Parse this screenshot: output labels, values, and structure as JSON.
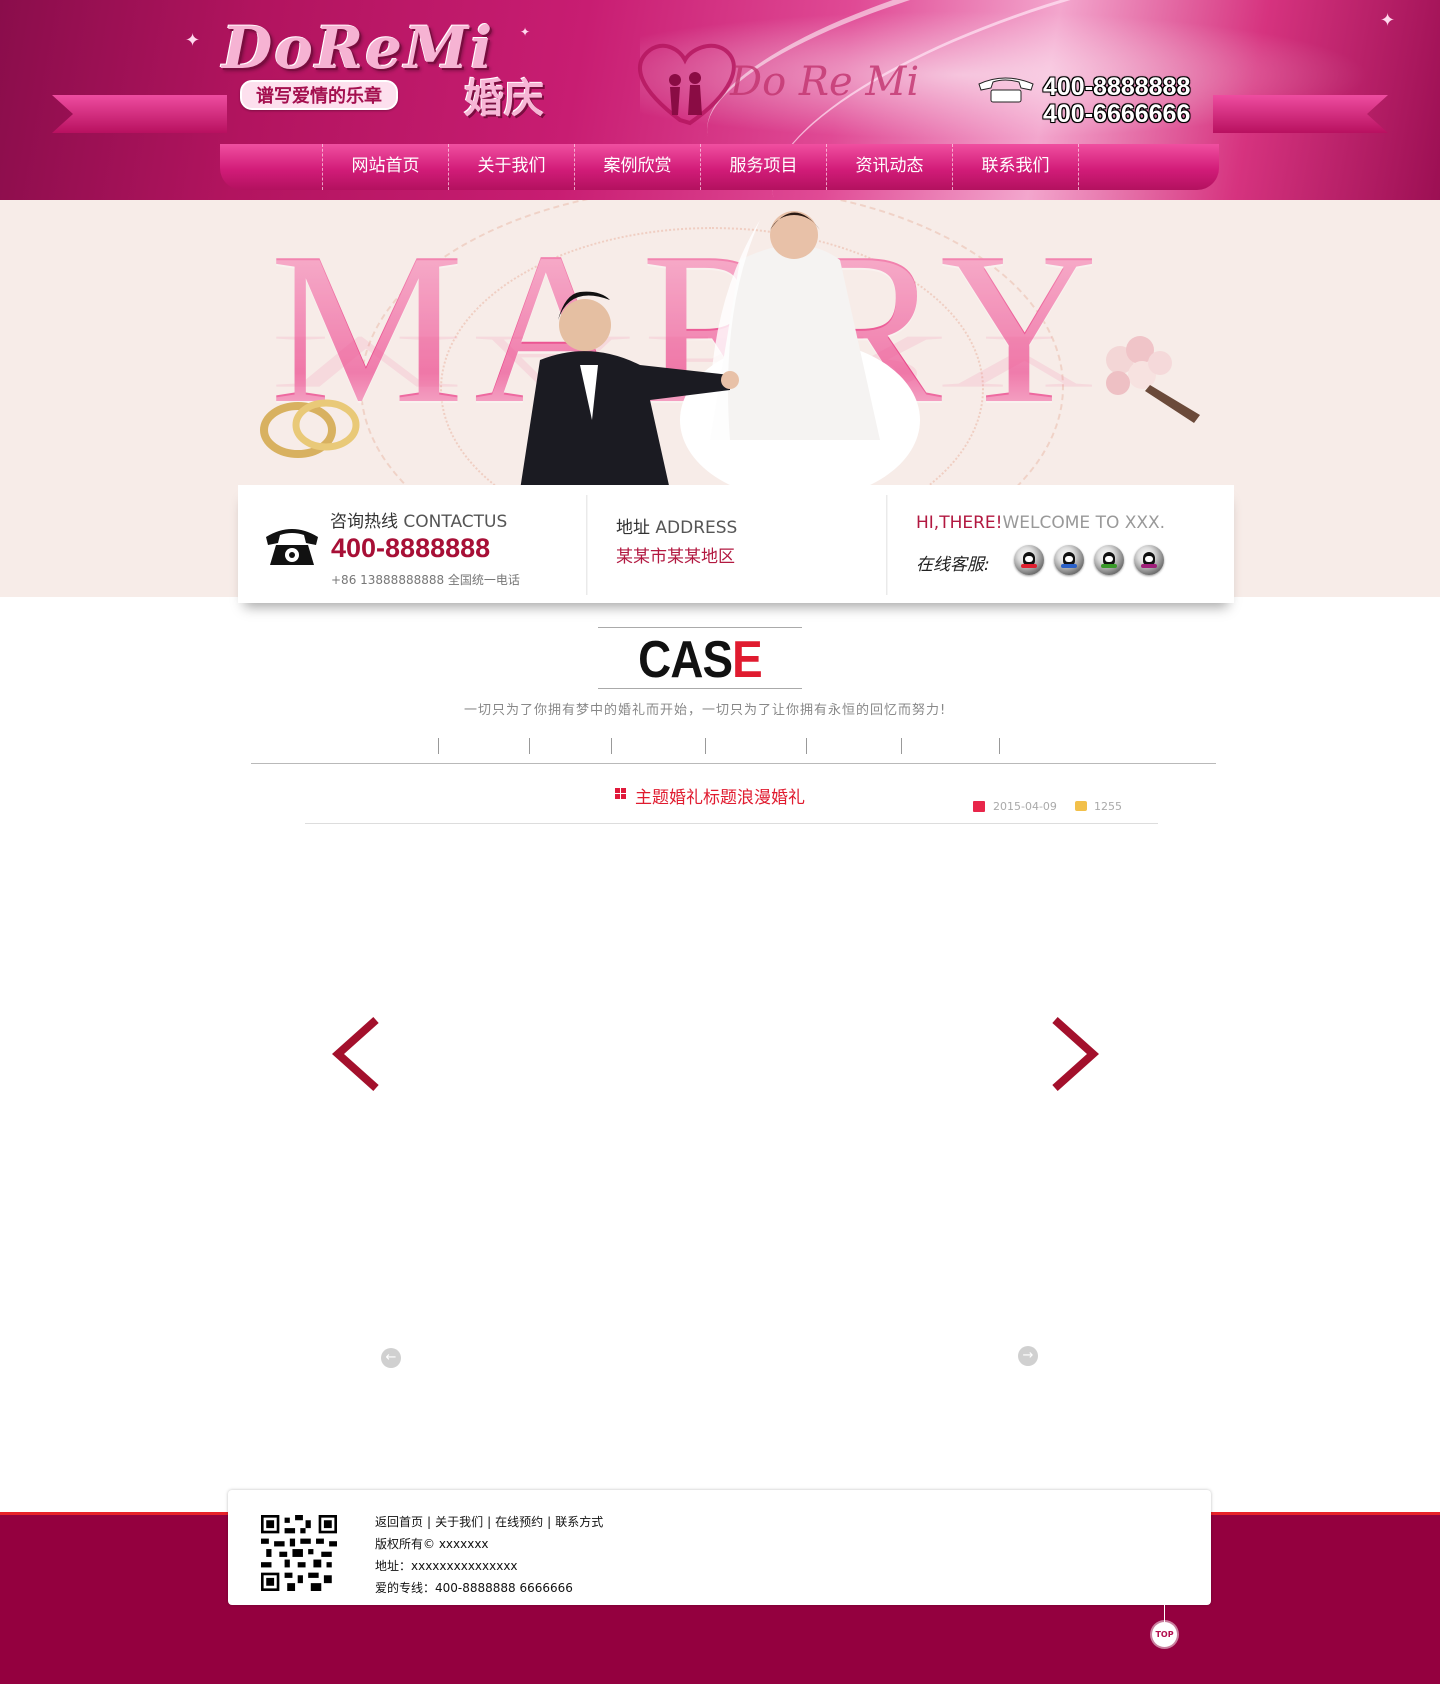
{
  "header": {
    "logo_word": "DoReMi",
    "logo_word_small": "婚庆",
    "slogan": "谱写爱情的乐章",
    "phones": [
      "400-8888888",
      "400-6666666"
    ]
  },
  "nav": {
    "items": [
      {
        "label": "网站首页"
      },
      {
        "label": "关于我们"
      },
      {
        "label": "案例欣赏"
      },
      {
        "label": "服务项目"
      },
      {
        "label": "资讯动态"
      },
      {
        "label": "联系我们"
      }
    ]
  },
  "banner": {
    "headline": "MARRY"
  },
  "contact": {
    "consult_label": "咨询热线",
    "consult_label_en": "CONTACTUS",
    "consult_number": "400-8888888",
    "consult_sub": "+86 13888888888 全国统一电话",
    "address_label": "地址",
    "address_label_en": "ADDRESS",
    "address_value": "某某市某某地区",
    "greeting_red": "HI,THERE!",
    "greeting_grey": "WELCOME TO XXX.",
    "service_label": "在线客服:",
    "qq_colors": [
      "#e02030",
      "#2b61c9",
      "#3a9a2a",
      "#a0207a"
    ]
  },
  "case": {
    "title_main": "CAS",
    "title_accent": "E",
    "tagline": "一切只为了你拥有梦中的婚礼而开始，一切只为了让你拥有永恒的回忆而努力!",
    "item": {
      "title": "主题婚礼标题浪漫婚礼",
      "date": "2015-04-09",
      "views": "1255"
    },
    "prev_small_icon": "←",
    "next_small_icon": "→"
  },
  "footer": {
    "links": [
      "返回首页",
      "关于我们",
      "在线预约",
      "联系方式"
    ],
    "copyright": "版权所有©   xxxxxxx",
    "address": "地址：xxxxxxxxxxxxxxx",
    "hotline": "爱的专线：400-8888888 6666666",
    "top_label": "TOP"
  },
  "colors": {
    "brand_pink": "#d21c79",
    "brand_dark": "#94003f",
    "accent_red": "#e01b2f"
  }
}
